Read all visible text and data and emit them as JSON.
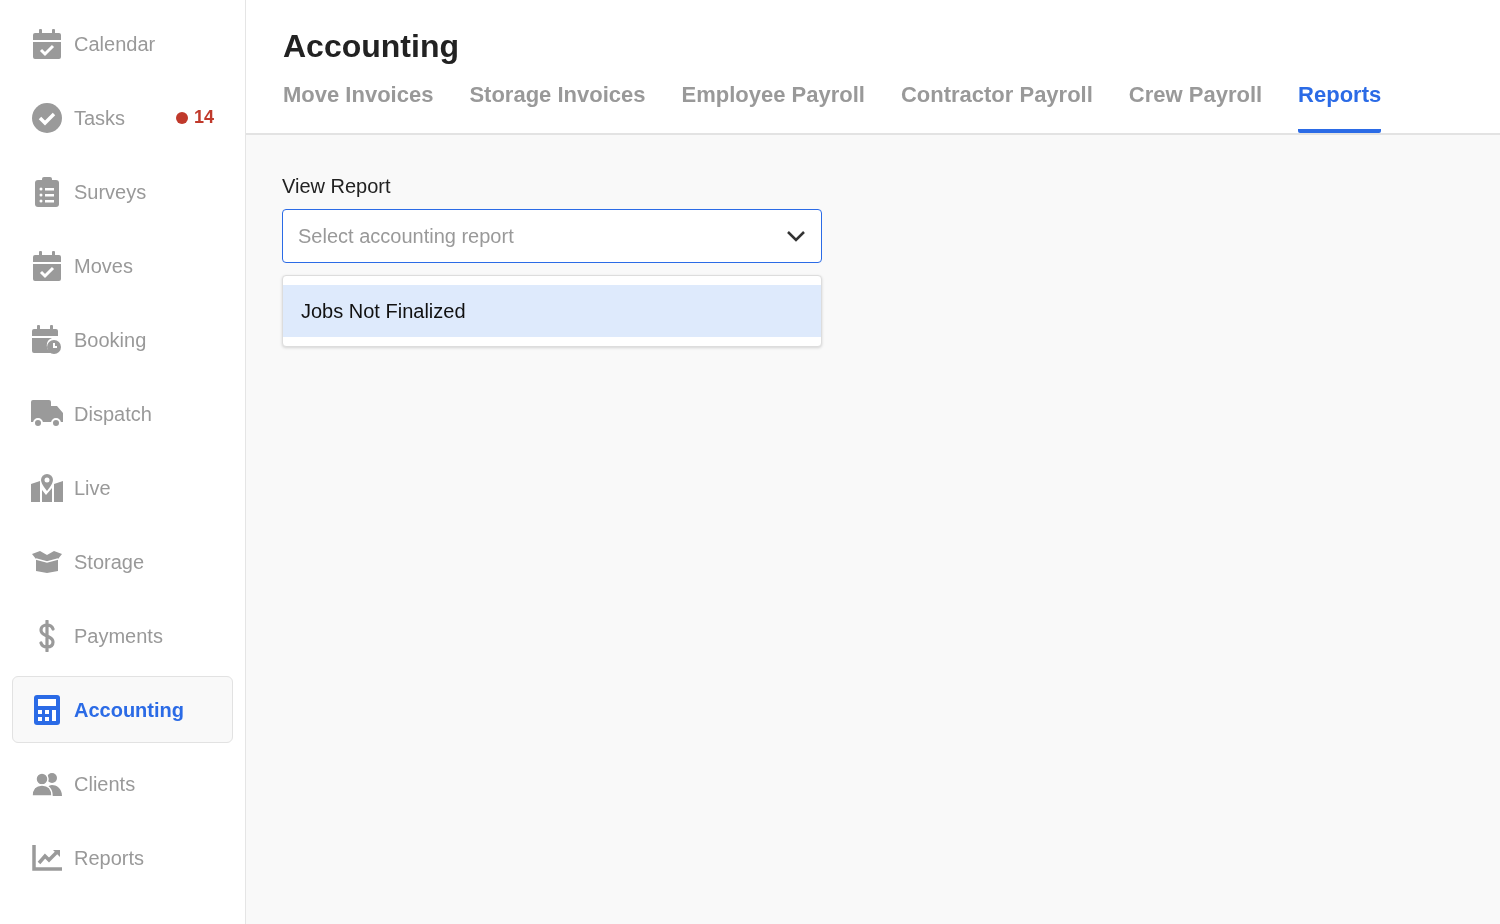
{
  "sidebar": {
    "items": [
      {
        "label": "Calendar",
        "selected": false
      },
      {
        "label": "Tasks",
        "selected": false,
        "badge": "14"
      },
      {
        "label": "Surveys",
        "selected": false
      },
      {
        "label": "Moves",
        "selected": false
      },
      {
        "label": "Booking",
        "selected": false
      },
      {
        "label": "Dispatch",
        "selected": false
      },
      {
        "label": "Live",
        "selected": false
      },
      {
        "label": "Storage",
        "selected": false
      },
      {
        "label": "Payments",
        "selected": false
      },
      {
        "label": "Accounting",
        "selected": true
      },
      {
        "label": "Clients",
        "selected": false
      },
      {
        "label": "Reports",
        "selected": false
      }
    ]
  },
  "page": {
    "title": "Accounting"
  },
  "tabs": [
    {
      "label": "Move Invoices",
      "selected": false
    },
    {
      "label": "Storage Invoices",
      "selected": false
    },
    {
      "label": "Employee Payroll",
      "selected": false
    },
    {
      "label": "Contractor Payroll",
      "selected": false
    },
    {
      "label": "Crew Payroll",
      "selected": false
    },
    {
      "label": "Reports",
      "selected": true
    }
  ],
  "report_select": {
    "label": "View Report",
    "placeholder": "Select accounting report",
    "expanded": true,
    "options": [
      {
        "label": "Jobs Not Finalized",
        "selected": true
      }
    ]
  }
}
